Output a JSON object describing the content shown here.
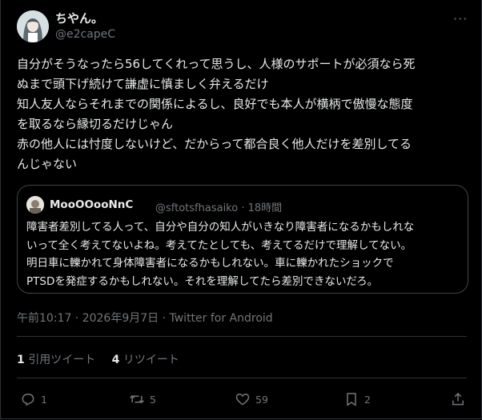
{
  "author": {
    "name": "ちやん。",
    "handle": "@e2capeC"
  },
  "more_label": "···",
  "tweet": {
    "text": "自分がそうなったら56してくれって思うし、人様のサポートが必須なら死\nぬまで頭下げ続けて謙虚に慎ましく弁えるだけ\n知人友人ならそれまでの関係によるし、良好でも本人が横柄で傲慢な態度\nを取るなら縁切るだけじゃん\n赤の他人には忖度しないけど、だからって都合良く他人だけを差別してる\nんじゃない"
  },
  "quote": {
    "name": "MooOOooNnC",
    "meta": "@sftotsfhasaiko · 18時間",
    "text": "障害者差別してる人って、自分や自分の知人がいきなり障害者になるかもしれな\nいって全く考えてないよね。考えてたとしても、考えてるだけで理解してない。\n明日車に轢かれて身体障害者になるかもしれない。車に轢かれたショックで\nPTSDを発症するかもしれない。それを理解してたら差別できないだろ。"
  },
  "timestamp": "午前10:17 · 2026年9月7日 · Twitter for Android",
  "stats": {
    "quote_count": "1",
    "quote_label": "引用ツイート",
    "retweet_count": "4",
    "retweet_label": "リツイート"
  },
  "actions": {
    "reply_count": "1",
    "retweet_count": "5",
    "like_count": "59",
    "bookmark_count": "2",
    "icons": [
      "reply-icon",
      "retweet-icon",
      "like-icon",
      "bookmark-icon",
      "share-icon"
    ]
  },
  "colors": {
    "background": "#000000",
    "text": "#e7e9ea",
    "muted": "#71767b",
    "border": "#2f3336"
  }
}
